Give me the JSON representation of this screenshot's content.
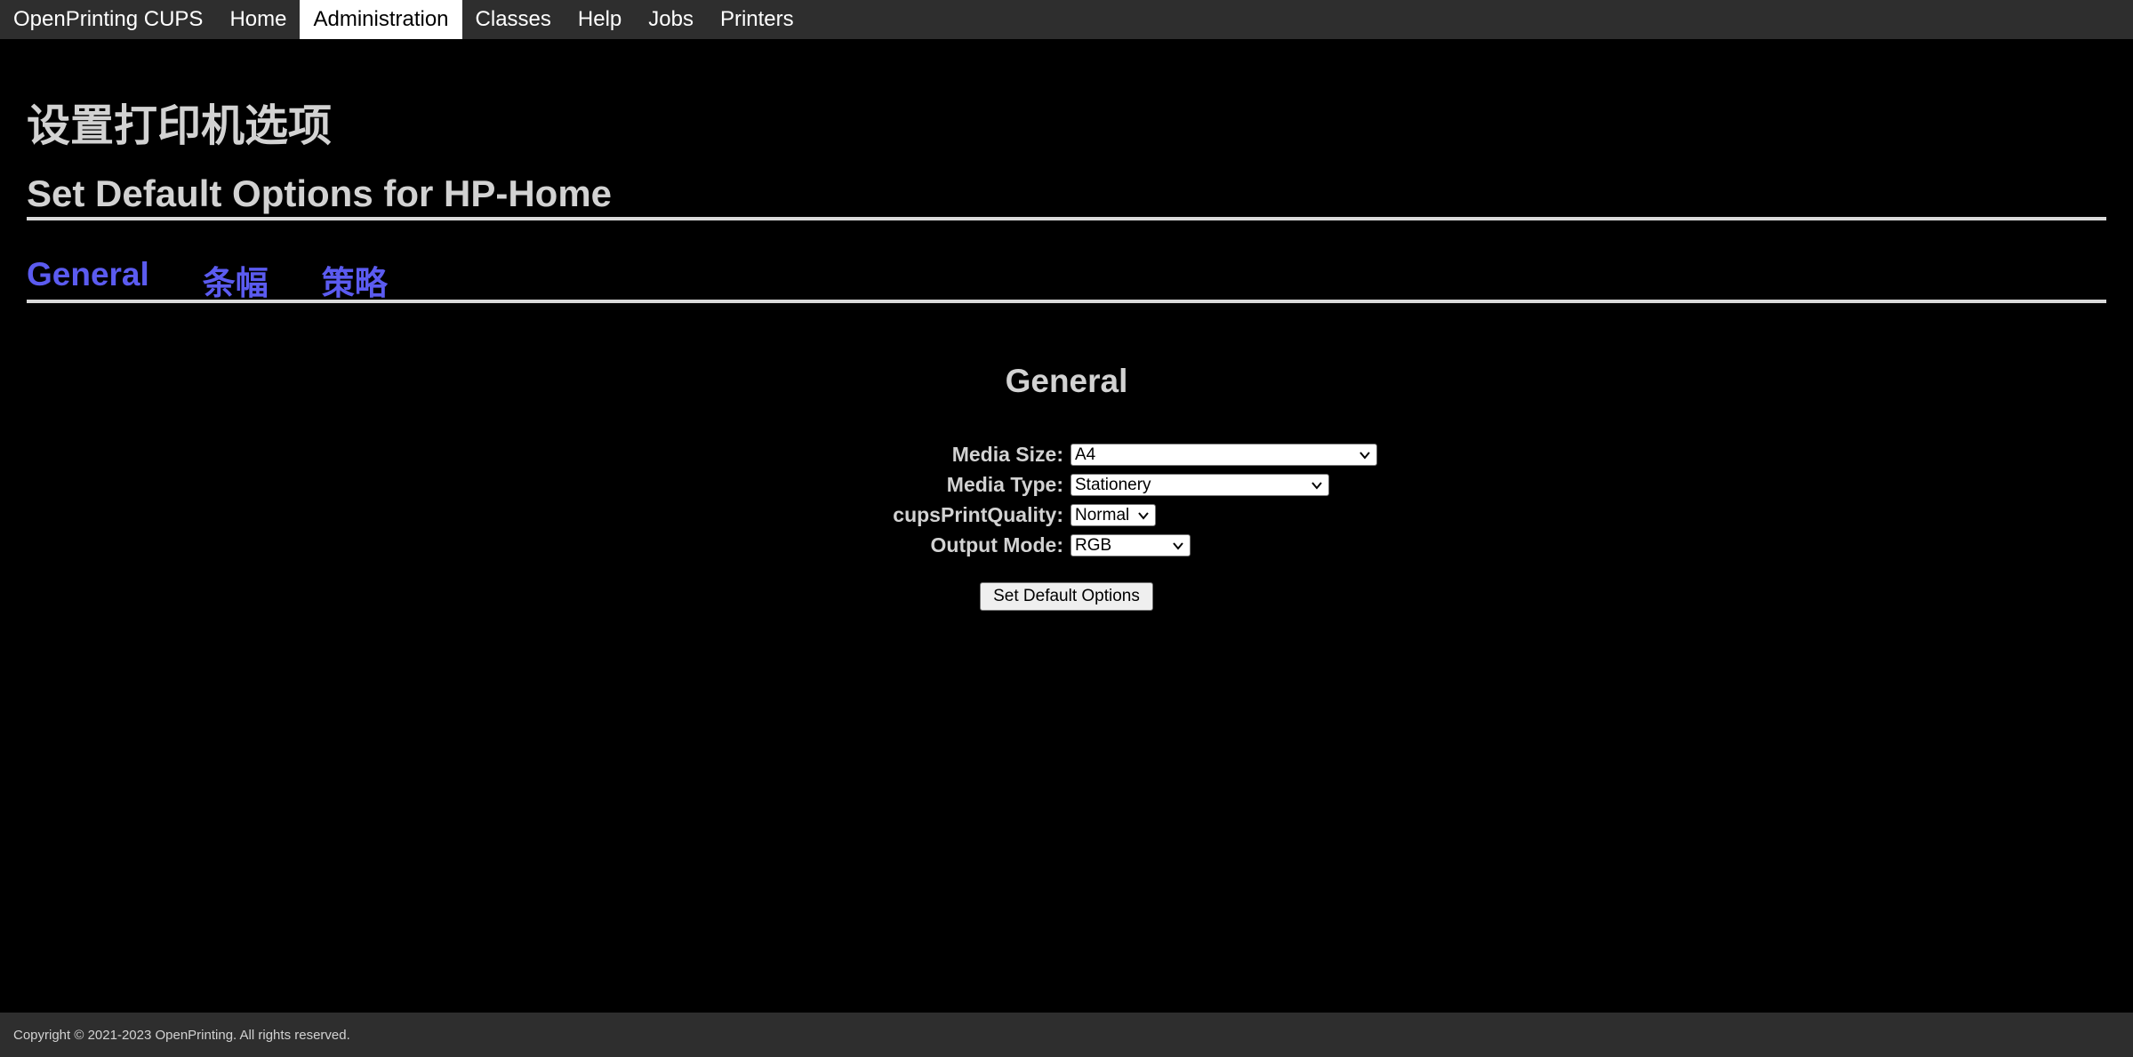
{
  "nav": {
    "brand": "OpenPrinting CUPS",
    "items": [
      "Home",
      "Administration",
      "Classes",
      "Help",
      "Jobs",
      "Printers"
    ],
    "active": "Administration"
  },
  "page": {
    "title_cn": "设置打印机选项",
    "title": "Set Default Options for HP-Home"
  },
  "tabs": [
    "General",
    "条幅",
    "策略"
  ],
  "section": {
    "title": "General",
    "fields": [
      {
        "label": "Media Size:",
        "value": "A4"
      },
      {
        "label": "Media Type:",
        "value": "Stationery"
      },
      {
        "label": "cupsPrintQuality:",
        "value": "Normal"
      },
      {
        "label": "Output Mode:",
        "value": "RGB"
      }
    ],
    "submit_label": "Set Default Options"
  },
  "footer": {
    "copyright": "Copyright © 2021-2023 OpenPrinting. All rights reserved."
  },
  "colors": {
    "background": "#000000",
    "nav_background": "#2e2e2e",
    "heading": "#d2d2d2",
    "tab_link": "#5b5bf0"
  }
}
